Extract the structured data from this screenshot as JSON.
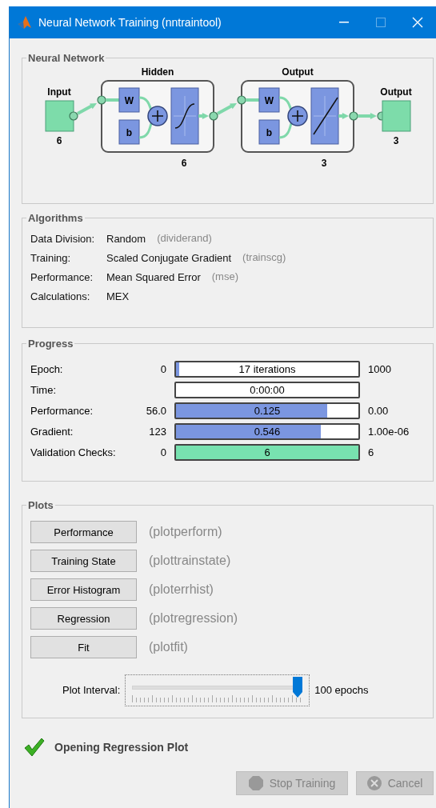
{
  "window": {
    "title": "Neural Network Training (nntraintool)",
    "controls": {
      "minimize_disabled": false,
      "maximize_disabled": true
    }
  },
  "network": {
    "title": "Neural Network",
    "input": {
      "label": "Input",
      "size": "6"
    },
    "layers": [
      {
        "title": "Hidden",
        "weight": "W",
        "bias": "b",
        "size": "6",
        "kind": "sigmoid"
      },
      {
        "title": "Output",
        "weight": "W",
        "bias": "b",
        "size": "3",
        "kind": "linear"
      }
    ],
    "output": {
      "label": "Output",
      "size": "3"
    }
  },
  "algorithms": {
    "title": "Algorithms",
    "rows": [
      {
        "label": "Data Division:",
        "value": "Random",
        "function": "(dividerand)"
      },
      {
        "label": "Training:",
        "value": "Scaled Conjugate Gradient",
        "function": "(trainscg)"
      },
      {
        "label": "Performance:",
        "value": "Mean Squared Error",
        "function": "(mse)"
      },
      {
        "label": "Calculations:",
        "value": "MEX"
      }
    ]
  },
  "progress": {
    "title": "Progress",
    "rows": [
      {
        "label": "Epoch:",
        "start": "0",
        "reading": "17 iterations",
        "end": "1000",
        "level": 0.012,
        "color": "#7b96e0"
      },
      {
        "label": "Time:",
        "reading": "0:00:00"
      },
      {
        "label": "Performance:",
        "start": "56.0",
        "reading": "0.125",
        "end": "0.00",
        "level": 0.83,
        "color": "#7b96e0"
      },
      {
        "label": "Gradient:",
        "start": "123",
        "reading": "0.546",
        "end": "1.00e-06",
        "level": 0.795,
        "color": "#7b96e0"
      },
      {
        "label": "Validation Checks:",
        "start": "0",
        "reading": "6",
        "end": "6",
        "level": 1,
        "color": "#78e2b0"
      }
    ]
  },
  "plots": {
    "title": "Plots",
    "buttons": [
      {
        "label": "Performance",
        "function": "(plotperform)"
      },
      {
        "label": "Training State",
        "function": "(plottrainstate)"
      },
      {
        "label": "Error Histogram",
        "function": "(ploterrhist)"
      },
      {
        "label": "Regression",
        "function": "(plotregression)"
      },
      {
        "label": "Fit",
        "function": "(plotfit)"
      }
    ],
    "interval": {
      "label": "Plot Interval:",
      "level": 1,
      "reading": "100 epochs"
    }
  },
  "status": {
    "text": "Opening Regression Plot",
    "ok": true
  },
  "buttons": [
    {
      "label": "Stop Training",
      "kind": "stop",
      "disabled": true
    },
    {
      "label": "Cancel",
      "kind": "cancel",
      "disabled": true
    }
  ]
}
